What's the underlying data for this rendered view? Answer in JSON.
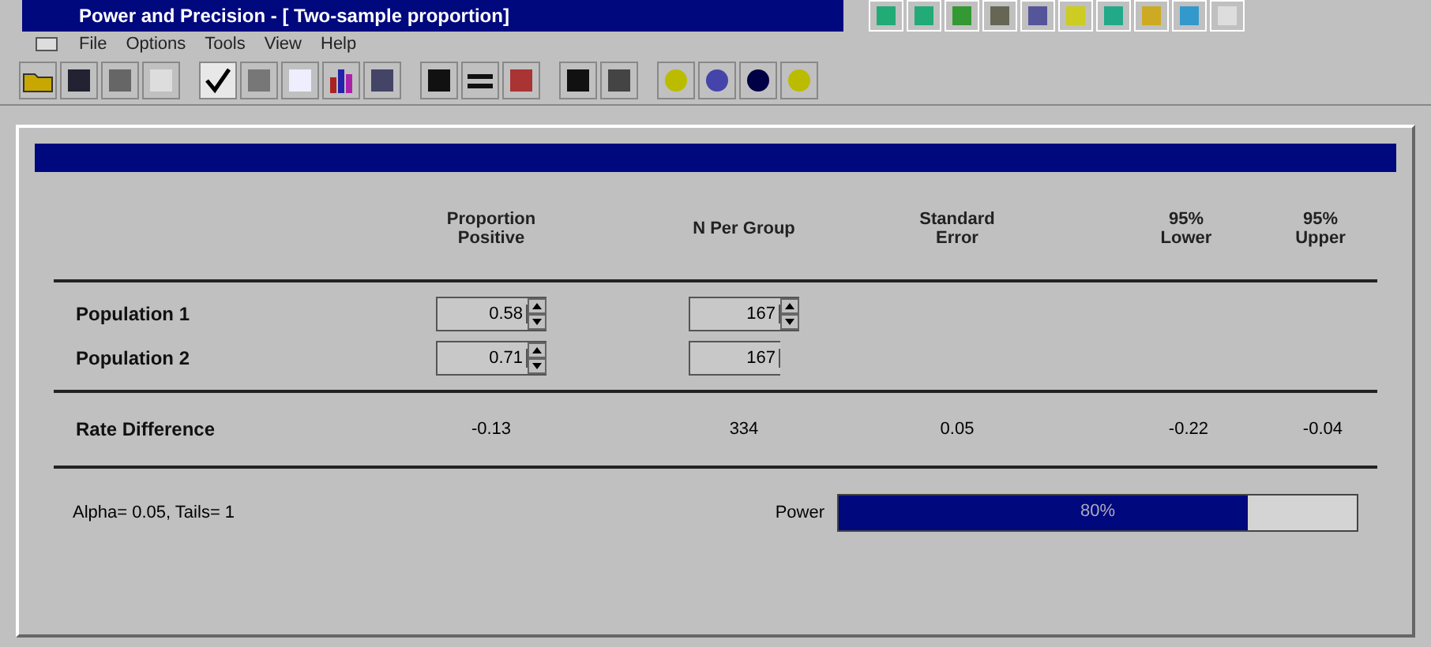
{
  "window": {
    "title": "Power and Precision - [ Two-sample proportion]"
  },
  "menu": [
    "File",
    "Options",
    "Tools",
    "View",
    "Help"
  ],
  "columns": [
    {
      "label": "Proportion Positive"
    },
    {
      "label": "N Per Group"
    },
    {
      "label": "Standard Error"
    },
    {
      "label": "95% Lower"
    },
    {
      "label": "95% Upper"
    }
  ],
  "populations": [
    {
      "label": "Population 1",
      "proportion": "0.58",
      "proportion_spinner": true,
      "n": "167",
      "n_spinner": true
    },
    {
      "label": "Population 2",
      "proportion": "0.71",
      "proportion_spinner": true,
      "n": "167",
      "n_spinner": false
    }
  ],
  "rate_difference": {
    "label": "Rate Difference",
    "values": [
      "-0.13",
      "334",
      "0.05",
      "-0.22",
      "-0.04"
    ]
  },
  "footer": {
    "settings": "Alpha= 0.05, Tails= 1",
    "power_label": "Power",
    "power_value": "80%",
    "level": 0.79
  }
}
